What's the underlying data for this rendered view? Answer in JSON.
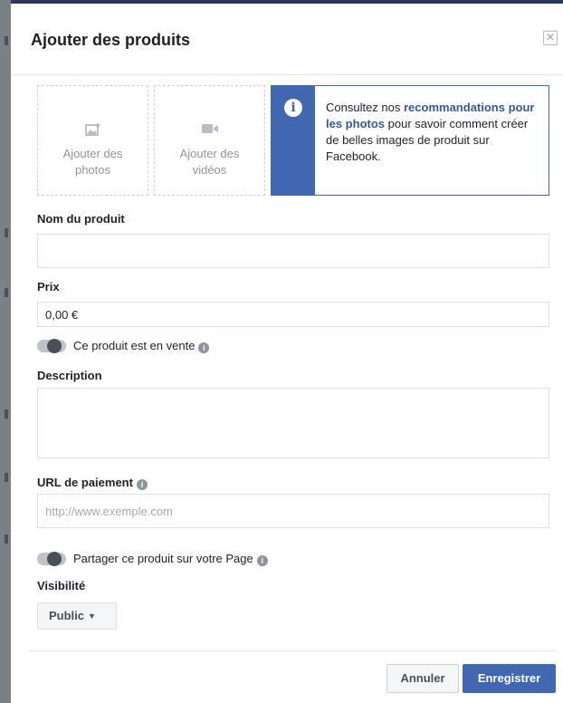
{
  "dialog": {
    "title": "Ajouter des produits",
    "close_icon": "close-icon"
  },
  "media": {
    "add_photos": {
      "line1": "Ajouter des",
      "line2": "photos",
      "icon": "photo-icon"
    },
    "add_videos": {
      "line1": "Ajouter des",
      "line2": "vidéos",
      "icon": "video-camera-icon"
    }
  },
  "tip": {
    "icon": "info-icon",
    "text_before": "Consultez nos ",
    "link": "recommandations pour les photos",
    "text_after": " pour savoir comment créer de belles images de produit sur Facebook."
  },
  "form": {
    "name_label": "Nom du produit",
    "name_value": "",
    "price_label": "Prix",
    "price_value": "0,00 €",
    "on_sale_label": "Ce produit est en vente",
    "on_sale_enabled": false,
    "description_label": "Description",
    "description_value": "",
    "payment_url_label": "URL de paiement",
    "payment_url_placeholder": "http://www.exemple.com",
    "share_label": "Partager ce produit sur votre Page",
    "share_enabled": false,
    "visibility_label": "Visibilité",
    "visibility_value": "Public"
  },
  "footer": {
    "cancel_label": "Annuler",
    "save_label": "Enregistrer"
  },
  "colors": {
    "accent": "#4267b2",
    "link": "#365899",
    "border": "#dddfe2"
  }
}
